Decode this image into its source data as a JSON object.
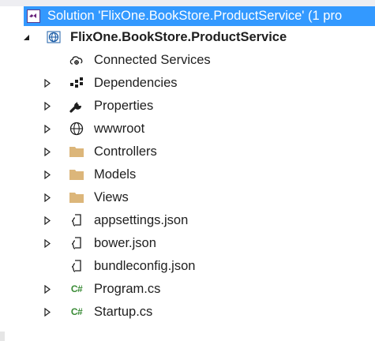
{
  "solution": {
    "label": "Solution 'FlixOne.BookStore.ProductService' (1 pro",
    "icon": "visual-studio-solution-icon"
  },
  "project": {
    "label": "FlixOne.BookStore.ProductService",
    "icon": "web-project-globe-icon",
    "expanded": true
  },
  "items": [
    {
      "label": "Connected Services",
      "icon": "connected-services-icon",
      "expandable": false
    },
    {
      "label": "Dependencies",
      "icon": "dependencies-icon",
      "expandable": true
    },
    {
      "label": "Properties",
      "icon": "wrench-icon",
      "expandable": true
    },
    {
      "label": "wwwroot",
      "icon": "globe-icon",
      "expandable": true
    },
    {
      "label": "Controllers",
      "icon": "folder-icon",
      "expandable": true
    },
    {
      "label": "Models",
      "icon": "folder-icon",
      "expandable": true
    },
    {
      "label": "Views",
      "icon": "folder-icon",
      "expandable": true
    },
    {
      "label": "appsettings.json",
      "icon": "json-file-icon",
      "expandable": true
    },
    {
      "label": "bower.json",
      "icon": "json-file-icon",
      "expandable": true
    },
    {
      "label": "bundleconfig.json",
      "icon": "json-file-icon",
      "expandable": false
    },
    {
      "label": "Program.cs",
      "icon": "csharp-file-icon",
      "expandable": true
    },
    {
      "label": "Startup.cs",
      "icon": "csharp-file-icon",
      "expandable": true
    }
  ],
  "csharp_badge": "C#",
  "colors": {
    "selection": "#3399ff",
    "folder": "#dcb67a",
    "csharp": "#388a34",
    "project_globe": "#1e5fa8"
  }
}
